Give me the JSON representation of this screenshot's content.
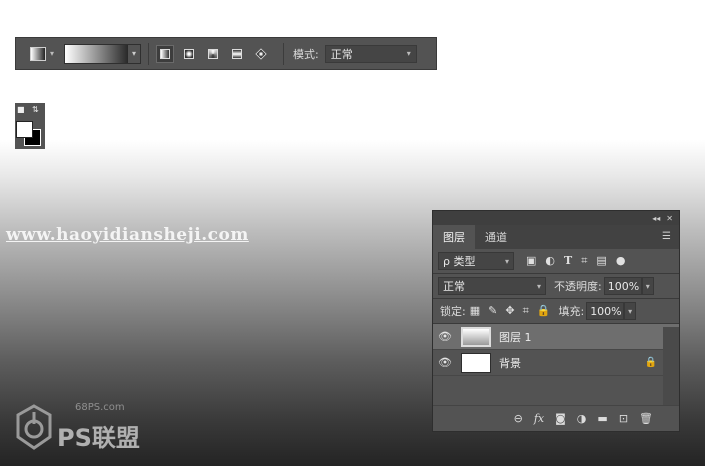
{
  "toolbar": {
    "mode_label": "模式:",
    "mode_value": "正常"
  },
  "watermark": {
    "url": "www.haoyidiansheji.com"
  },
  "logo": {
    "site": "68PS.com",
    "text": "PS联盟"
  },
  "layers_panel": {
    "tabs": [
      {
        "label": "图层",
        "active": true
      },
      {
        "label": "通道",
        "active": false
      }
    ],
    "filter_value": "ρ 类型",
    "blend_mode": "正常",
    "opacity_label": "不透明度:",
    "opacity_value": "100%",
    "lock_label": "锁定:",
    "fill_label": "填充:",
    "fill_value": "100%",
    "layers": [
      {
        "name": "图层 1",
        "selected": true,
        "thumbnail": "gradient"
      },
      {
        "name": "背景",
        "selected": false,
        "thumbnail": "white",
        "locked": true
      }
    ]
  },
  "colors": {
    "toolbar_bg": "#535353",
    "panel_bg": "#535353",
    "selected_layer": "#6e6e6e",
    "foreground": "#ffffff",
    "background": "#000000"
  }
}
